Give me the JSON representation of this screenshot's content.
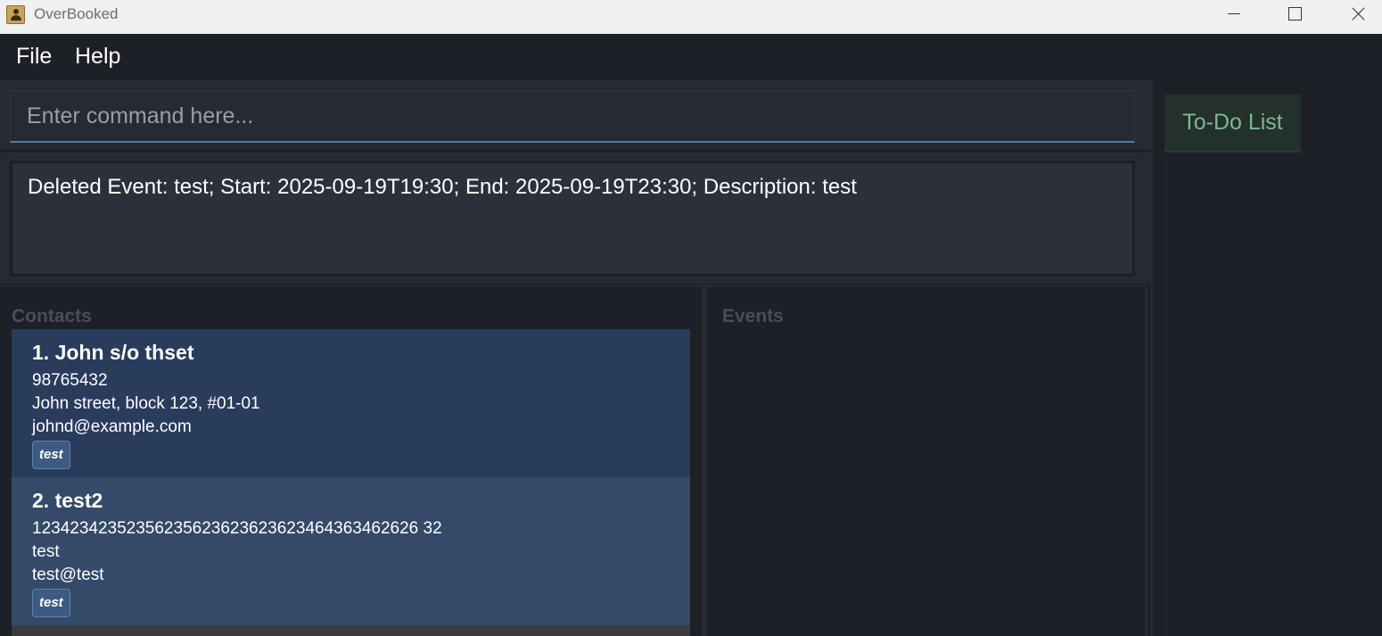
{
  "window": {
    "title": "OverBooked"
  },
  "menu": {
    "file": "File",
    "help": "Help"
  },
  "command": {
    "placeholder": "Enter command here...",
    "value": ""
  },
  "result": {
    "text": "Deleted Event: test; Start: 2025-09-19T19:30; End: 2025-09-19T23:30; Description: test"
  },
  "contacts": {
    "title": "Contacts",
    "items": [
      {
        "name": "1. John s/o thset",
        "phone": "98765432",
        "address": "John street, block 123, #01-01",
        "email": "johnd@example.com",
        "tags": [
          "test"
        ]
      },
      {
        "name": "2. test2",
        "phone": "12342342352356235623623623623464363462626 32",
        "address": "test",
        "email": "test@test",
        "tags": [
          "test"
        ]
      }
    ]
  },
  "events": {
    "title": "Events"
  },
  "todo": {
    "tab_label": "To-Do List"
  },
  "colors": {
    "background": "#1d2027",
    "card_selected": "#293c5c",
    "card": "#344a68",
    "todo_text": "#7cb98d",
    "input_underline": "#4f7da6"
  }
}
